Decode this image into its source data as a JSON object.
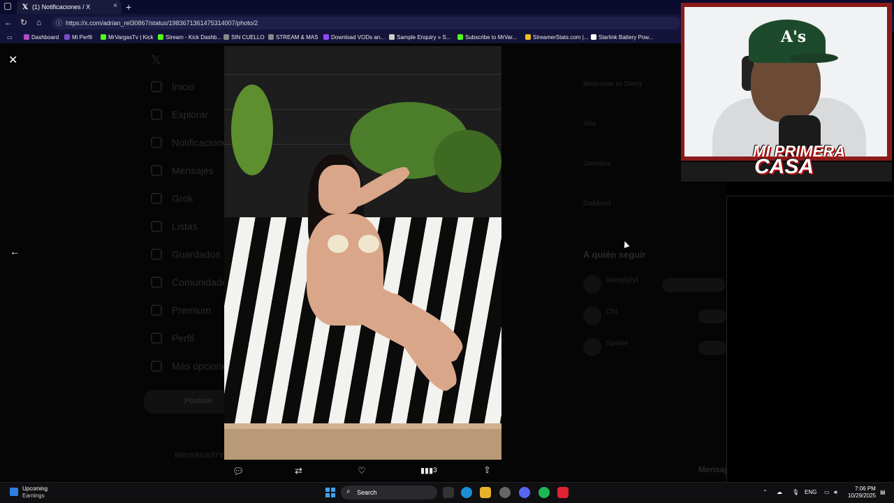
{
  "browser": {
    "tab_title": "(1) Notificaciones / X",
    "tab_close": "×",
    "new_tab": "+",
    "url": "https://x.com/adrian_rel30867/status/1983671361475314007/photo/2",
    "nav": {
      "back": "←",
      "reload": "↻",
      "home": "⌂",
      "lock": "ⓘ"
    },
    "bookmarks": [
      {
        "label": "Dashboard",
        "color": "#b44cc9"
      },
      {
        "label": "Mi Perfil",
        "color": "#7b4cc9"
      },
      {
        "label": "MrVargasTv | Kick",
        "color": "#53fc18"
      },
      {
        "label": "Stream - Kick Dashb...",
        "color": "#53fc18"
      },
      {
        "label": "SIN CUELLO",
        "color": "#888888"
      },
      {
        "label": "STREAM & MAS",
        "color": "#888888"
      },
      {
        "label": "Download VODs an...",
        "color": "#9146ff"
      },
      {
        "label": "Sample Enquiry » S...",
        "color": "#cccccc"
      },
      {
        "label": "Subscribe to MrVar...",
        "color": "#53fc18"
      },
      {
        "label": "StreamerStats.com |...",
        "color": "#f0c020"
      },
      {
        "label": "Starlink Battery Pow...",
        "color": "#ffffff"
      }
    ]
  },
  "background_nav": {
    "items": [
      "Inicio",
      "Explorar",
      "Notificaciones",
      "Mensajes",
      "Grok",
      "Listas",
      "Guardados",
      "Comunidades",
      "Premium",
      "Perfil",
      "Más opciones"
    ],
    "post_button": "Postear",
    "account": "MRVARGASTV"
  },
  "background_right": {
    "section_title": "A quién seguir",
    "trends": [
      "Welcome to Derry",
      "Vito",
      "Jamaica",
      "Oakland"
    ],
    "suggestions": [
      "llamplylyl",
      "Chi",
      "Spider"
    ],
    "messages_label": "Mensajes"
  },
  "viewer": {
    "close_icon": "✕",
    "back_icon": "←",
    "view_count": "3"
  },
  "webcam": {
    "cap_logo": "A's",
    "logo_line1": "MI PRIMERA",
    "logo_line2": "CASA"
  },
  "taskbar": {
    "widget_title": "Upcoming",
    "widget_sub": "Earnings",
    "search_placeholder": "Search",
    "language": "ENG",
    "time": "7:06 PM",
    "date": "10/29/2025"
  },
  "colors": {
    "tab_bg": "#1a1a3d",
    "chrome_bg": "#14143a",
    "accent_frame": "#8a1b1b",
    "windows_blue": "#3ba3f5"
  }
}
